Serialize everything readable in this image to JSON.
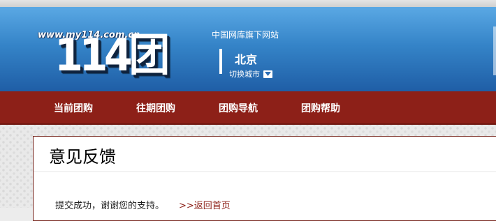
{
  "header": {
    "logo_url_text": "www.my114.com.cn",
    "logo_text": "114团",
    "tagline": "中国网库旗下网站",
    "city": "北京",
    "switch_city_label": "切换城市"
  },
  "nav": {
    "items": [
      {
        "label": "当前团购"
      },
      {
        "label": "往期团购"
      },
      {
        "label": "团购导航"
      },
      {
        "label": "团购帮助"
      }
    ]
  },
  "feedback": {
    "title": "意见反馈",
    "message": "提交成功，谢谢您的支持。",
    "back_link": ">>返回首页"
  },
  "colors": {
    "header_top": "#5aa8e4",
    "header_bottom": "#1f5ea6",
    "nav_background": "#8d2018",
    "link_color": "#8d2018"
  },
  "icons": {
    "city_dropdown": "chevron-down-icon"
  }
}
